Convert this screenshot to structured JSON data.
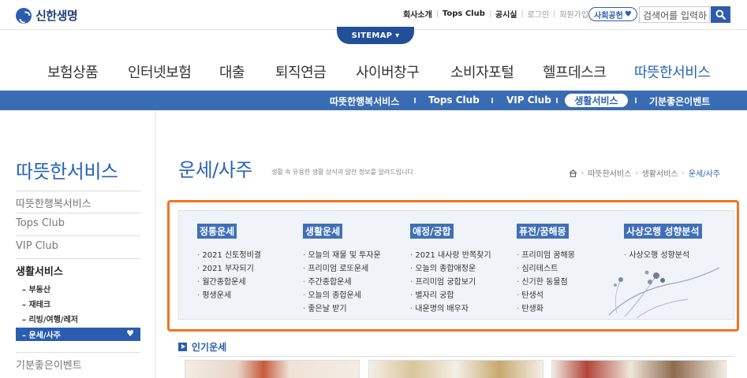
{
  "brand": {
    "name": "신한생명"
  },
  "util_links": [
    "회사소개",
    "Tops Club",
    "공시실",
    "로그인",
    "회원가입"
  ],
  "social_button": {
    "label": "사회공헌",
    "icon": "heart-icon"
  },
  "search": {
    "placeholder": "검색어를 입력하",
    "icon": "search-icon"
  },
  "sitemap": {
    "label": "SITEMAP ▾"
  },
  "gnb": {
    "items": [
      {
        "label": "보험상품"
      },
      {
        "label": "인터넷보험"
      },
      {
        "label": "대출"
      },
      {
        "label": "퇴직연금"
      },
      {
        "label": "사이버창구"
      },
      {
        "label": "소비자포털"
      },
      {
        "label": "헬프데스크"
      },
      {
        "label": "따뜻한서비스",
        "active": true
      }
    ]
  },
  "lnb": {
    "items": [
      {
        "label": "따뜻한행복서비스"
      },
      {
        "label": "Tops Club"
      },
      {
        "label": "VIP Club"
      },
      {
        "label": "생활서비스",
        "active": true
      },
      {
        "label": "기분좋은이벤트"
      }
    ]
  },
  "sidebar": {
    "title": "따뜻한서비스",
    "items": [
      "따뜻한행복서비스",
      "Tops Club",
      "VIP Club",
      "생활서비스"
    ],
    "sub_items": [
      "부동산",
      "재테크",
      "리빙/여행/레저"
    ],
    "active_sub": "– 운세/사주",
    "bottom_item": "기분좋은이벤트"
  },
  "page": {
    "title": "운세/사주",
    "description": "생활 속 유용한 생활 상식과 알찬 정보를 알려드립니다.",
    "breadcrumb": [
      "따뜻한서비스",
      "생활서비스",
      "운세/사주"
    ]
  },
  "categories": [
    {
      "title": "정통운세",
      "items": [
        "2021 신토정비결",
        "2021 부자되기",
        "월간종합운세",
        "평생운세"
      ]
    },
    {
      "title": "생활운세",
      "items": [
        "오늘의 재물 및 투자운",
        "프리미엄 로또운세",
        "주간종합운세",
        "오늘의 종합운세",
        "좋은날 받기"
      ]
    },
    {
      "title": "애정/궁합",
      "items": [
        "2021 내사랑 반쪽찾기",
        "오늘의 종합애정운",
        "프리미엄 궁합보기",
        "별자리 궁합",
        "내운명의 배우자"
      ]
    },
    {
      "title": "퓨전/꿈해몽",
      "items": [
        "프리미엄 꿈해몽",
        "심리테스트",
        "신기한 동물점",
        "탄생석",
        "탄생화"
      ]
    },
    {
      "title": "사상오행 성향분석",
      "items": [
        "사상오행 성향분석"
      ]
    }
  ],
  "popular": {
    "title": "인기운세"
  },
  "colors": {
    "brand_blue": "#2a5db0",
    "highlight_orange": "#f07422",
    "panel_bg": "#f0f3f7"
  }
}
